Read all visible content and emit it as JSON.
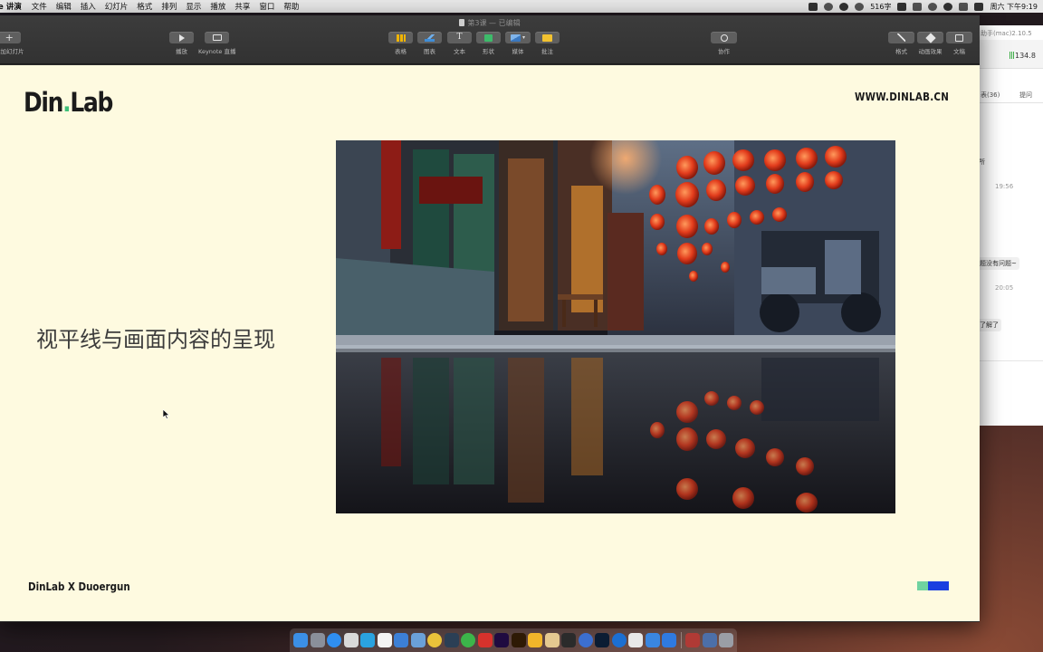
{
  "menubar": {
    "app_name": "e 讲演",
    "menus": [
      "文件",
      "编辑",
      "插入",
      "幻灯片",
      "格式",
      "排列",
      "显示",
      "播放",
      "共享",
      "窗口",
      "帮助"
    ],
    "status_text": "516字",
    "clock": "周六 下午9:19"
  },
  "chat_window": {
    "title_fragment": "助手(mac)2.10.5",
    "signal_value": "134.8",
    "tab_left": "表(36)",
    "tab_right": "提问",
    "msg_1": "所",
    "time_1": "19:56",
    "bubble_1": "题没有问题~",
    "time_2": "20:05",
    "bubble_2": "了解了"
  },
  "window": {
    "doc_title": "第3课",
    "doc_status": "— 已编辑"
  },
  "toolbar": {
    "add_slide_label": "添加幻灯片",
    "play_label": "播放",
    "keynote_live_label": "Keynote 直播",
    "table_label": "表格",
    "chart_label": "图表",
    "text_label": "文本",
    "shape_label": "形状",
    "media_label": "媒体",
    "comment_label": "批注",
    "collaborate_label": "协作",
    "format_label": "格式",
    "animate_label": "动画效果",
    "document_label": "文稿"
  },
  "slide": {
    "logo_part1": "Din",
    "logo_dot": ".",
    "logo_part2": "Lab",
    "website": "WWW.DINLAB.CN",
    "heading": "视平线与画面内容的呈现",
    "footer_credit": "DinLab X Duoergun",
    "accent_colors": [
      "#6fd3a0",
      "#1a3fe0"
    ],
    "photo_subject": "lantern-lined alley reflected in puddle"
  },
  "dock": {
    "icons": [
      "finder-icon",
      "launchpad-icon",
      "safari-icon",
      "photos-icon",
      "telegram-icon",
      "calendar-icon",
      "xcode-icon",
      "preview-icon",
      "chrome-icon",
      "quicktime-icon",
      "wechat-icon",
      "app-red-icon",
      "after-effects-icon",
      "illustrator-icon",
      "sketch-icon",
      "compressor-icon",
      "davinci-icon",
      "connect-icon",
      "photoshop-icon",
      "browser-icon",
      "wps-icon",
      "keynote-icon",
      "pages-icon",
      "downloads-icon",
      "folder-icon",
      "trash-icon"
    ]
  }
}
